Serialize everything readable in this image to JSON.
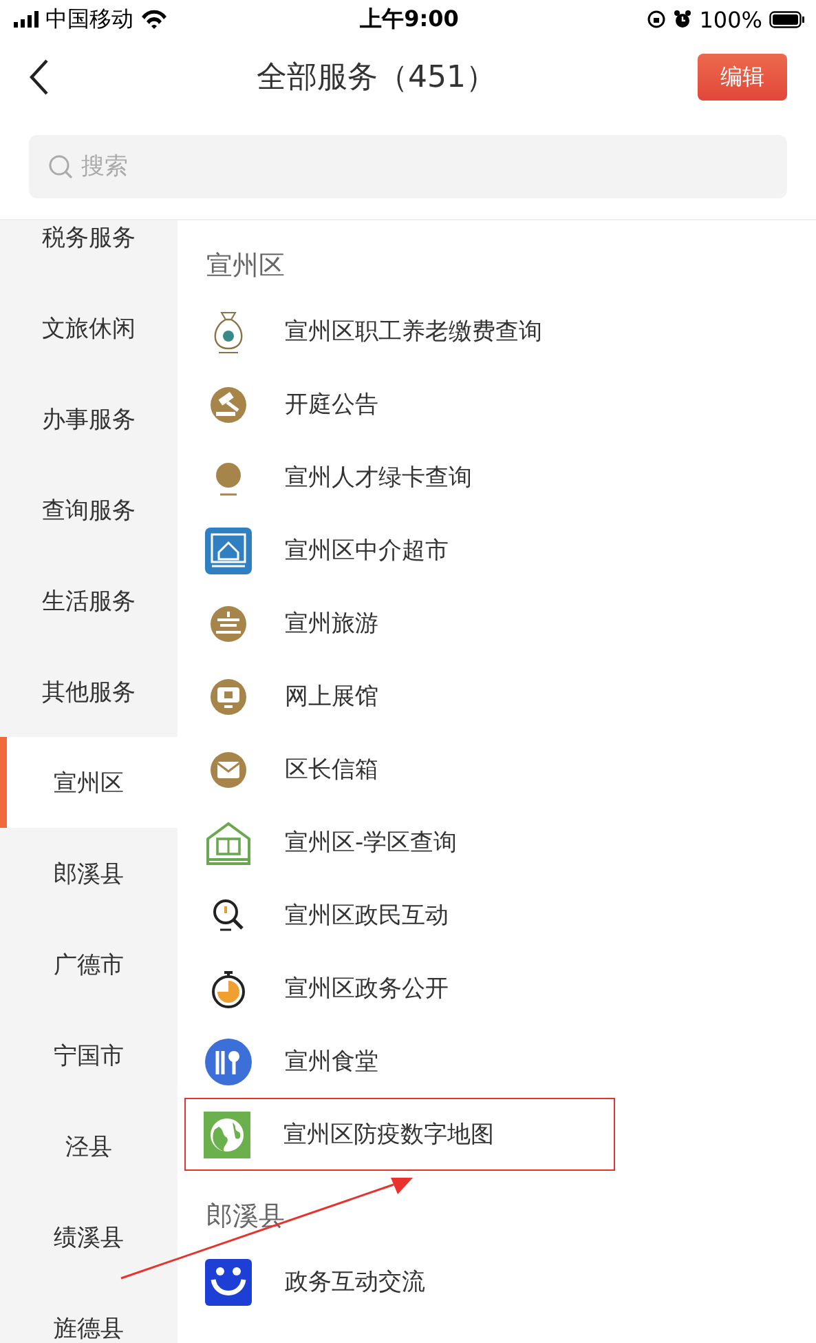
{
  "status_bar": {
    "carrier": "中国移动",
    "time": "上午9:00",
    "battery": "100%"
  },
  "nav": {
    "title": "全部服务（451）",
    "edit_button": "编辑"
  },
  "search": {
    "placeholder": "搜索"
  },
  "sidebar": {
    "items": [
      {
        "label": "税务服务",
        "selected": false
      },
      {
        "label": "文旅休闲",
        "selected": false
      },
      {
        "label": "办事服务",
        "selected": false
      },
      {
        "label": "查询服务",
        "selected": false
      },
      {
        "label": "生活服务",
        "selected": false
      },
      {
        "label": "其他服务",
        "selected": false
      },
      {
        "label": "宣州区",
        "selected": true
      },
      {
        "label": "郎溪县",
        "selected": false
      },
      {
        "label": "广德市",
        "selected": false
      },
      {
        "label": "宁国市",
        "selected": false
      },
      {
        "label": "泾县",
        "selected": false
      },
      {
        "label": "绩溪县",
        "selected": false
      },
      {
        "label": "旌德县",
        "selected": false
      }
    ]
  },
  "sections": [
    {
      "title": "宣州区",
      "items": [
        {
          "label": "宣州区职工养老缴费查询",
          "highlighted": false
        },
        {
          "label": "开庭公告",
          "highlighted": false
        },
        {
          "label": "宣州人才绿卡查询",
          "highlighted": false
        },
        {
          "label": "宣州区中介超市",
          "highlighted": false
        },
        {
          "label": "宣州旅游",
          "highlighted": false
        },
        {
          "label": "网上展馆",
          "highlighted": false
        },
        {
          "label": "区长信箱",
          "highlighted": false
        },
        {
          "label": "宣州区-学区查询",
          "highlighted": false
        },
        {
          "label": "宣州区政民互动",
          "highlighted": false
        },
        {
          "label": "宣州区政务公开",
          "highlighted": false
        },
        {
          "label": "宣州食堂",
          "highlighted": false
        },
        {
          "label": "宣州区防疫数字地图",
          "highlighted": true
        }
      ]
    },
    {
      "title": "郎溪县",
      "items": [
        {
          "label": "政务互动交流",
          "highlighted": false
        }
      ]
    }
  ]
}
